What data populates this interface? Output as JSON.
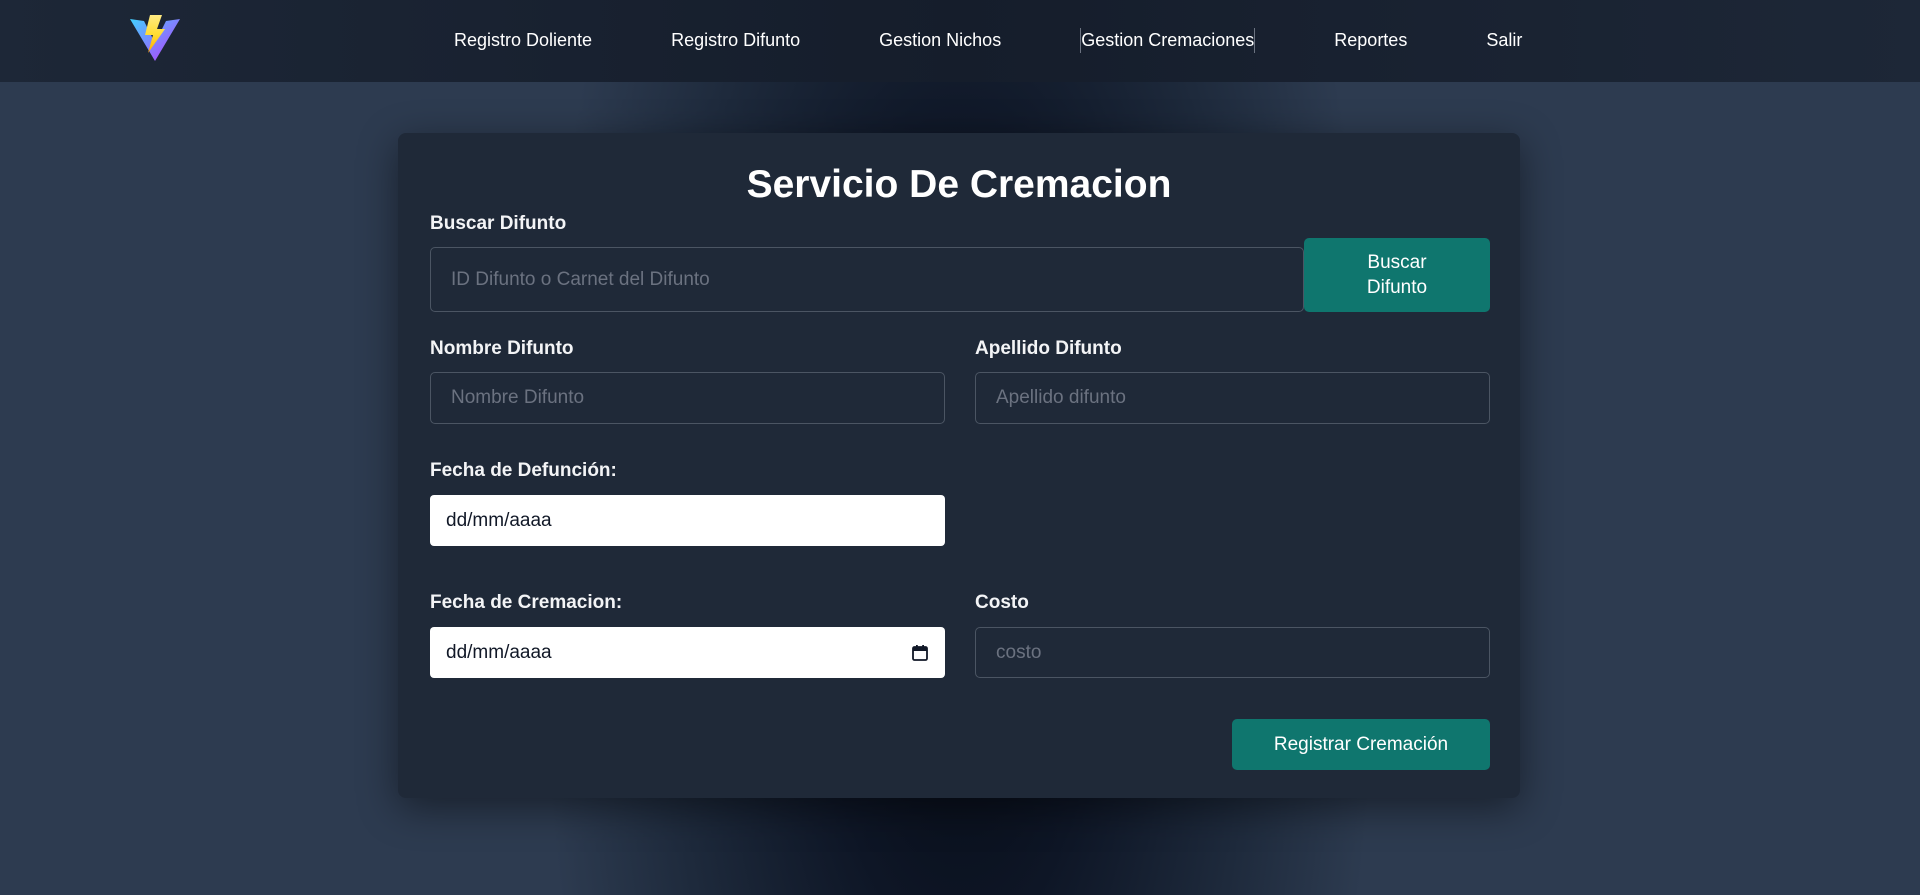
{
  "nav": {
    "logo_name": "vite-logo-icon",
    "links": [
      {
        "label": "Registro Doliente"
      },
      {
        "label": "Registro Difunto"
      },
      {
        "label": "Gestion Nichos"
      },
      {
        "label": "Gestion Cremaciones"
      },
      {
        "label": "Reportes"
      },
      {
        "label": "Salir"
      }
    ]
  },
  "form": {
    "title": "Servicio De Cremacion",
    "search": {
      "label": "Buscar Difunto",
      "placeholder": "ID Difunto o Carnet del Difunto",
      "value": "",
      "button_label": "Buscar Difunto"
    },
    "nombre": {
      "label": "Nombre Difunto",
      "placeholder": "Nombre Difunto",
      "value": ""
    },
    "apellido": {
      "label": "Apellido Difunto",
      "placeholder": "Apellido difunto",
      "value": ""
    },
    "fecha_defuncion": {
      "label": "Fecha de Defunción:",
      "value": "dd/mm/aaaa"
    },
    "fecha_cremacion": {
      "label": "Fecha de Cremacion:",
      "value": "dd/mm/aaaa",
      "icon": "calendar-icon"
    },
    "costo": {
      "label": "Costo",
      "placeholder": "costo",
      "value": ""
    },
    "submit_label": "Registrar Cremación"
  },
  "colors": {
    "accent": "#0f766e",
    "card_bg": "#1f2938",
    "navbar_bg": "#1a2332",
    "input_border": "#4b5563"
  }
}
